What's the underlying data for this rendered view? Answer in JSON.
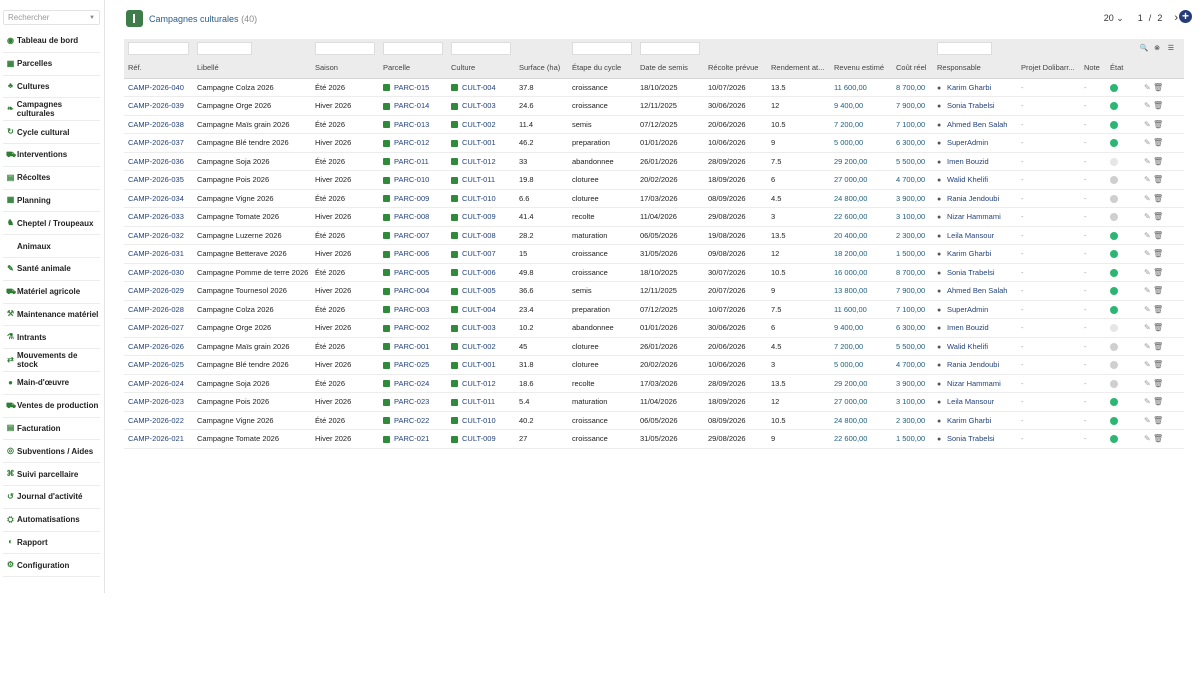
{
  "sidebar": {
    "search_placeholder": "Rechercher",
    "items": [
      {
        "label": "Tableau de bord",
        "icon": "dashboard-icon"
      },
      {
        "label": "Parcelles",
        "icon": "map-icon"
      },
      {
        "label": "Cultures",
        "icon": "plant-icon"
      },
      {
        "label": "Campagnes culturales",
        "icon": "leaf-icon"
      },
      {
        "label": "Cycle cultural",
        "icon": "refresh-icon"
      },
      {
        "label": "Interventions",
        "icon": "tractor-icon"
      },
      {
        "label": "Récoltes",
        "icon": "basket-icon"
      },
      {
        "label": "Planning",
        "icon": "calendar-icon"
      },
      {
        "label": "Cheptel / Troupeaux",
        "icon": "cow-icon"
      },
      {
        "label": "Animaux",
        "icon": "",
        "sub": true
      },
      {
        "label": "Santé animale",
        "icon": "syringe-icon"
      },
      {
        "label": "Matériel agricole",
        "icon": "tractor-icon"
      },
      {
        "label": "Maintenance matériel",
        "icon": "wrench-icon"
      },
      {
        "label": "Intrants",
        "icon": "flask-icon"
      },
      {
        "label": "Mouvements de stock",
        "icon": "swap-icon"
      },
      {
        "label": "Main-d'œuvre",
        "icon": "user-icon"
      },
      {
        "label": "Ventes de production",
        "icon": "cart-icon"
      },
      {
        "label": "Facturation",
        "icon": "invoice-icon"
      },
      {
        "label": "Subventions / Aides",
        "icon": "coins-icon"
      },
      {
        "label": "Suivi parcellaire",
        "icon": "tracking-icon"
      },
      {
        "label": "Journal d'activité",
        "icon": "history-icon"
      },
      {
        "label": "Automatisations",
        "icon": "robot-icon"
      },
      {
        "label": "Rapport",
        "icon": "report-icon"
      },
      {
        "label": "Configuration",
        "icon": "gear-icon"
      }
    ]
  },
  "header": {
    "title": "Campagnes culturales",
    "count": "(40)",
    "page_size": "20",
    "page": "1",
    "separator": "/",
    "total_pages": "2"
  },
  "columns": [
    "Réf.",
    "Libellé",
    "Saison",
    "Parcelle",
    "Culture",
    "Surface (ha)",
    "Étape du cycle",
    "Date de semis",
    "Récolte prévue",
    "Rendement at...",
    "Revenu estimé",
    "Coût réel",
    "Responsable",
    "Projet Dolibarr...",
    "Note",
    "État"
  ],
  "rows": [
    [
      "CAMP-2026-040",
      "Campagne Colza 2026",
      "Été 2026",
      "PARC-015",
      "CULT-004",
      "37.8",
      "croissance",
      "18/10/2025",
      "10/07/2026",
      "13.5",
      "11 600,00",
      "8 700,00",
      "Karim Gharbi",
      "-",
      "-",
      "green"
    ],
    [
      "CAMP-2026-039",
      "Campagne Orge 2026",
      "Hiver 2026",
      "PARC-014",
      "CULT-003",
      "24.6",
      "croissance",
      "12/11/2025",
      "30/06/2026",
      "12",
      "9 400,00",
      "7 900,00",
      "Sonia Trabelsi",
      "-",
      "-",
      "green"
    ],
    [
      "CAMP-2026-038",
      "Campagne Maïs grain 2026",
      "Été 2026",
      "PARC-013",
      "CULT-002",
      "11.4",
      "semis",
      "07/12/2025",
      "20/06/2026",
      "10.5",
      "7 200,00",
      "7 100,00",
      "Ahmed Ben Salah",
      "-",
      "-",
      "green"
    ],
    [
      "CAMP-2026-037",
      "Campagne Blé tendre 2026",
      "Hiver 2026",
      "PARC-012",
      "CULT-001",
      "46.2",
      "preparation",
      "01/01/2026",
      "10/06/2026",
      "9",
      "5 000,00",
      "6 300,00",
      "SuperAdmin",
      "-",
      "-",
      "green"
    ],
    [
      "CAMP-2026-036",
      "Campagne Soja 2026",
      "Été 2026",
      "PARC-011",
      "CULT-012",
      "33",
      "abandonnee",
      "26/01/2026",
      "28/09/2026",
      "7.5",
      "29 200,00",
      "5 500,00",
      "Imen Bouzid",
      "-",
      "-",
      "light"
    ],
    [
      "CAMP-2026-035",
      "Campagne Pois 2026",
      "Hiver 2026",
      "PARC-010",
      "CULT-011",
      "19.8",
      "cloturee",
      "20/02/2026",
      "18/09/2026",
      "6",
      "27 000,00",
      "4 700,00",
      "Walid Khelifi",
      "-",
      "-",
      "grey"
    ],
    [
      "CAMP-2026-034",
      "Campagne Vigne 2026",
      "Été 2026",
      "PARC-009",
      "CULT-010",
      "6.6",
      "cloturee",
      "17/03/2026",
      "08/09/2026",
      "4.5",
      "24 800,00",
      "3 900,00",
      "Rania Jendoubi",
      "-",
      "-",
      "grey"
    ],
    [
      "CAMP-2026-033",
      "Campagne Tomate 2026",
      "Hiver 2026",
      "PARC-008",
      "CULT-009",
      "41.4",
      "recolte",
      "11/04/2026",
      "29/08/2026",
      "3",
      "22 600,00",
      "3 100,00",
      "Nizar Hammami",
      "-",
      "-",
      "grey"
    ],
    [
      "CAMP-2026-032",
      "Campagne Luzerne 2026",
      "Été 2026",
      "PARC-007",
      "CULT-008",
      "28.2",
      "maturation",
      "06/05/2026",
      "19/08/2026",
      "13.5",
      "20 400,00",
      "2 300,00",
      "Leila Mansour",
      "-",
      "-",
      "green"
    ],
    [
      "CAMP-2026-031",
      "Campagne Betterave 2026",
      "Hiver 2026",
      "PARC-006",
      "CULT-007",
      "15",
      "croissance",
      "31/05/2026",
      "09/08/2026",
      "12",
      "18 200,00",
      "1 500,00",
      "Karim Gharbi",
      "-",
      "-",
      "green"
    ],
    [
      "CAMP-2026-030",
      "Campagne Pomme de terre 2026",
      "Été 2026",
      "PARC-005",
      "CULT-006",
      "49.8",
      "croissance",
      "18/10/2025",
      "30/07/2026",
      "10.5",
      "16 000,00",
      "8 700,00",
      "Sonia Trabelsi",
      "-",
      "-",
      "green"
    ],
    [
      "CAMP-2026-029",
      "Campagne Tournesol 2026",
      "Hiver 2026",
      "PARC-004",
      "CULT-005",
      "36.6",
      "semis",
      "12/11/2025",
      "20/07/2026",
      "9",
      "13 800,00",
      "7 900,00",
      "Ahmed Ben Salah",
      "-",
      "-",
      "green"
    ],
    [
      "CAMP-2026-028",
      "Campagne Colza 2026",
      "Été 2026",
      "PARC-003",
      "CULT-004",
      "23.4",
      "preparation",
      "07/12/2025",
      "10/07/2026",
      "7.5",
      "11 600,00",
      "7 100,00",
      "SuperAdmin",
      "-",
      "-",
      "green"
    ],
    [
      "CAMP-2026-027",
      "Campagne Orge 2026",
      "Hiver 2026",
      "PARC-002",
      "CULT-003",
      "10.2",
      "abandonnee",
      "01/01/2026",
      "30/06/2026",
      "6",
      "9 400,00",
      "6 300,00",
      "Imen Bouzid",
      "-",
      "-",
      "light"
    ],
    [
      "CAMP-2026-026",
      "Campagne Maïs grain 2026",
      "Été 2026",
      "PARC-001",
      "CULT-002",
      "45",
      "cloturee",
      "26/01/2026",
      "20/06/2026",
      "4.5",
      "7 200,00",
      "5 500,00",
      "Walid Khelifi",
      "-",
      "-",
      "grey"
    ],
    [
      "CAMP-2026-025",
      "Campagne Blé tendre 2026",
      "Hiver 2026",
      "PARC-025",
      "CULT-001",
      "31.8",
      "cloturee",
      "20/02/2026",
      "10/06/2026",
      "3",
      "5 000,00",
      "4 700,00",
      "Rania Jendoubi",
      "-",
      "-",
      "grey"
    ],
    [
      "CAMP-2026-024",
      "Campagne Soja 2026",
      "Été 2026",
      "PARC-024",
      "CULT-012",
      "18.6",
      "recolte",
      "17/03/2026",
      "28/09/2026",
      "13.5",
      "29 200,00",
      "3 900,00",
      "Nizar Hammami",
      "-",
      "-",
      "grey"
    ],
    [
      "CAMP-2026-023",
      "Campagne Pois 2026",
      "Hiver 2026",
      "PARC-023",
      "CULT-011",
      "5.4",
      "maturation",
      "11/04/2026",
      "18/09/2026",
      "12",
      "27 000,00",
      "3 100,00",
      "Leila Mansour",
      "-",
      "-",
      "green"
    ],
    [
      "CAMP-2026-022",
      "Campagne Vigne 2026",
      "Été 2026",
      "PARC-022",
      "CULT-010",
      "40.2",
      "croissance",
      "06/05/2026",
      "08/09/2026",
      "10.5",
      "24 800,00",
      "2 300,00",
      "Karim Gharbi",
      "-",
      "-",
      "green"
    ],
    [
      "CAMP-2026-021",
      "Campagne Tomate 2026",
      "Hiver 2026",
      "PARC-021",
      "CULT-009",
      "27",
      "croissance",
      "31/05/2026",
      "29/08/2026",
      "9",
      "22 600,00",
      "1 500,00",
      "Sonia Trabelsi",
      "-",
      "-",
      "green"
    ]
  ],
  "colors": {
    "green": "#2bb673",
    "grey": "#cfcfcf",
    "light": "#e6e6e6"
  },
  "icons": {
    "edit": "pencil-icon",
    "delete": "trash-icon",
    "search": "search-icon",
    "clear": "clear-filter-icon",
    "columns": "column-selector-icon"
  }
}
